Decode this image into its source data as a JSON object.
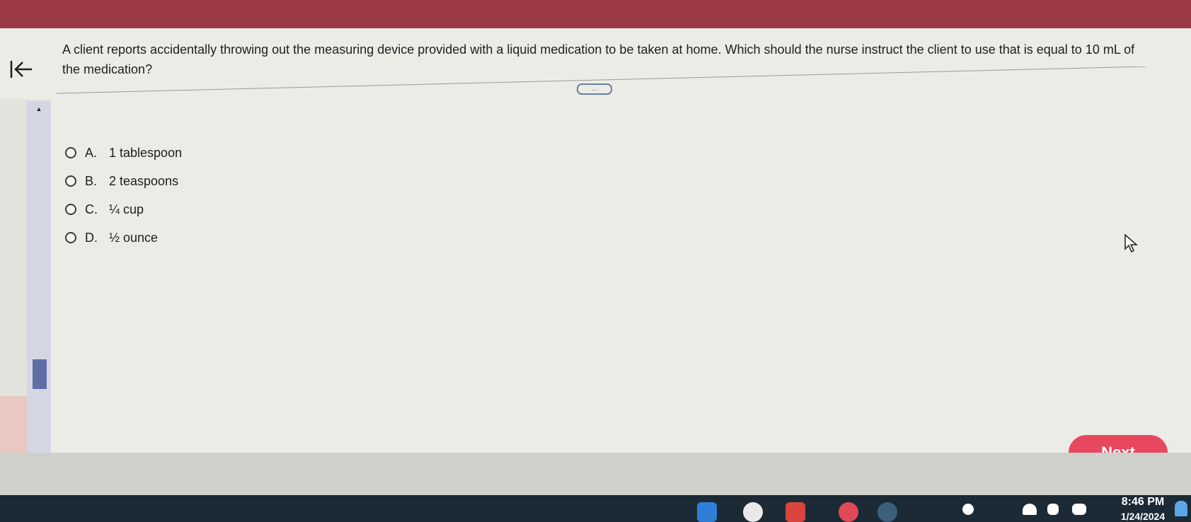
{
  "question": {
    "text": "A client reports accidentally throwing out the measuring device provided with a liquid medication to be taken at home. Which should the nurse instruct the client to use that is equal to 10 mL of the medication?"
  },
  "resize_handle": {
    "label": "..."
  },
  "options": [
    {
      "letter": "A.",
      "text": "1 tablespoon"
    },
    {
      "letter": "B.",
      "text": "2 teaspoons"
    },
    {
      "letter": "C.",
      "text": "¼ cup"
    },
    {
      "letter": "D.",
      "text": "½ ounce"
    }
  ],
  "navigation": {
    "next_label": "Next"
  },
  "taskbar": {
    "time": "8:46 PM",
    "date": "1/24/2024"
  },
  "colors": {
    "header_bar": "#9b3a45",
    "next_button": "#e8485f",
    "scroll_thumb": "#5f6fa6"
  },
  "icons": {
    "back": "arrow-left-to-bar-icon",
    "scroll_up": "caret-up-icon",
    "scroll_down": "caret-down-icon",
    "cursor": "mouse-pointer-icon"
  }
}
